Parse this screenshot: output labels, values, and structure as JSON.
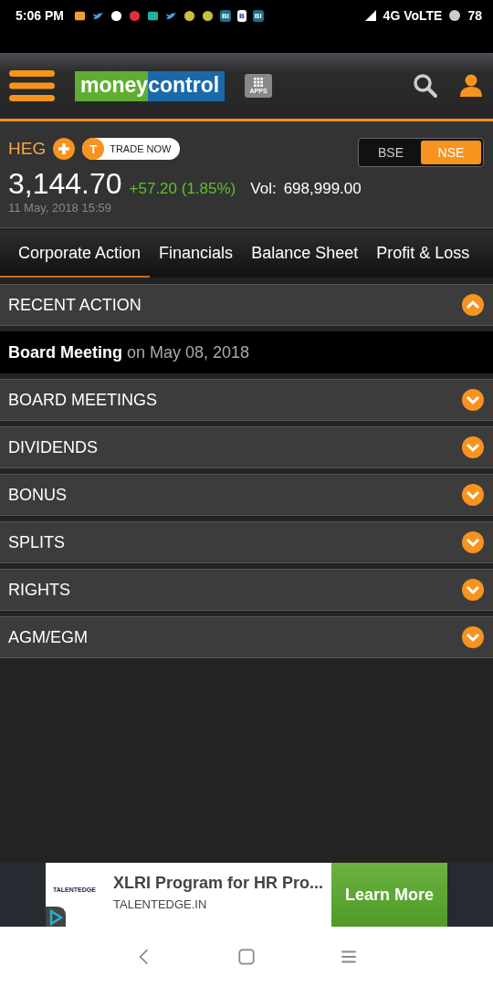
{
  "status_bar": {
    "time": "5:06 PM",
    "icons": [
      {
        "kind": "square",
        "color": "#f0a030"
      },
      {
        "kind": "bird",
        "color": "#4aa3df"
      },
      {
        "kind": "circle",
        "color": "#ffffff"
      },
      {
        "kind": "circle",
        "color": "#e03040"
      },
      {
        "kind": "square",
        "color": "#20b0a0"
      },
      {
        "kind": "bird",
        "color": "#4aa3df"
      },
      {
        "kind": "circle",
        "color": "#c8c040"
      },
      {
        "kind": "circle",
        "color": "#c8c040"
      },
      {
        "kind": "text",
        "label": "BI",
        "color": "#1d6f8a"
      },
      {
        "kind": "text",
        "label": "B",
        "color": "#ffffff"
      },
      {
        "kind": "text",
        "label": "BI",
        "color": "#1d6f8a"
      }
    ],
    "network": "4G VoLTE",
    "battery": "78"
  },
  "header": {
    "logo_left": "money",
    "logo_right": "control",
    "apps_label": "APPS"
  },
  "stock": {
    "symbol": "HEG",
    "trade_label": "TRADE NOW",
    "trade_icon": "T",
    "exchanges": [
      {
        "label": "BSE",
        "selected": false
      },
      {
        "label": "NSE",
        "selected": true
      }
    ],
    "price": "3,144.70",
    "change": "+57.20 (1.85%)",
    "volume_label": "Vol:",
    "volume": "698,999.00",
    "timestamp": "11 May, 2018 15:59"
  },
  "tabs": [
    {
      "label": "Corporate Action",
      "selected": true
    },
    {
      "label": "Financials",
      "selected": false
    },
    {
      "label": "Balance Sheet",
      "selected": false
    },
    {
      "label": "Profit & Loss",
      "selected": false
    }
  ],
  "sections": [
    {
      "title": "RECENT ACTION",
      "expanded": true,
      "entry": {
        "event": "Board Meeting",
        "date": "on May 08, 2018"
      }
    },
    {
      "title": "BOARD MEETINGS",
      "expanded": false
    },
    {
      "title": "DIVIDENDS",
      "expanded": false
    },
    {
      "title": "BONUS",
      "expanded": false
    },
    {
      "title": "SPLITS",
      "expanded": false
    },
    {
      "title": "RIGHTS",
      "expanded": false
    },
    {
      "title": "AGM/EGM",
      "expanded": false
    }
  ],
  "ad": {
    "logo": "TALENTEDGE",
    "headline": "XLRI Program for HR Pro...",
    "domain": "TALENTEDGE.IN",
    "button": "Learn More"
  }
}
